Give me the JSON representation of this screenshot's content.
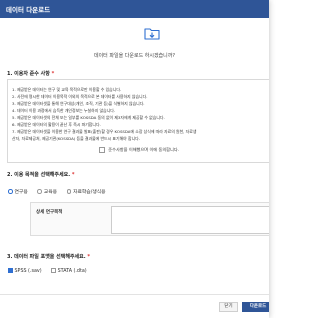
{
  "dialog": {
    "title": "데이터 다운로드",
    "confirm_message": "데이터 파일을 다운로드 하시겠습니까?"
  },
  "section1": {
    "title": "1. 이용자 준수 사항",
    "required_mark": "*",
    "notes": [
      "1. 제공받은 데이터는 연구 및 교육 목적으로만 이용할 수 있습니다.",
      "2. 사전에 명시한 데이터 이용목적 이외의 목적으로 본 데이터를 사용하지 않습니다.",
      "3. 제공받은 데이터셋을 통해 연구대상(개인, 조직, 기관 등)을 식별하지 않습니다.",
      "4. 데이터 이용 과정에서 습득한 개인정보는 누설하지 않습니다.",
      "5. 제공받은 데이터셋의 전체 또는 일부를 KOSSDA 동의 없이 제3자에게 제공할 수 없습니다.",
      "6. 제공받은 데이터의 활용이 끝난 후 즉시 파기합니다.",
      "7. 제공받은 데이터셋을 이용한 연구 결과물 발표(출판)할 경우 KOSSDA에 소장 상식에 따라 자료의 원천, 자료생",
      "산자, 자료제공처, 제공기관(KOSSDA) 등을 결과물에 반드시 표기해야 합니다."
    ],
    "agree_label": "준수사항을 이해했으며 이에 동의합니다."
  },
  "section2": {
    "title": "2. 이용 목적을 선택해주세요.",
    "required_mark": "*",
    "options": [
      "연구용",
      "교육용",
      "자료학습/생식용"
    ],
    "selected": "연구용",
    "detail_label": "상세 연구목적"
  },
  "section3": {
    "title": "3. 데이터 파일 포맷을 선택해주세요.",
    "required_mark": "*",
    "options": [
      "SPSS (.sav)",
      "STATA (.dta)"
    ],
    "checked": [
      "SPSS (.sav)"
    ]
  },
  "buttons": {
    "close_label": "닫기",
    "download_label": "다운로드"
  },
  "colors": {
    "header": "#2f5597",
    "accent": "#2f6fd1",
    "required": "#dd3333"
  },
  "icons": {
    "download": "folder-download-icon"
  }
}
